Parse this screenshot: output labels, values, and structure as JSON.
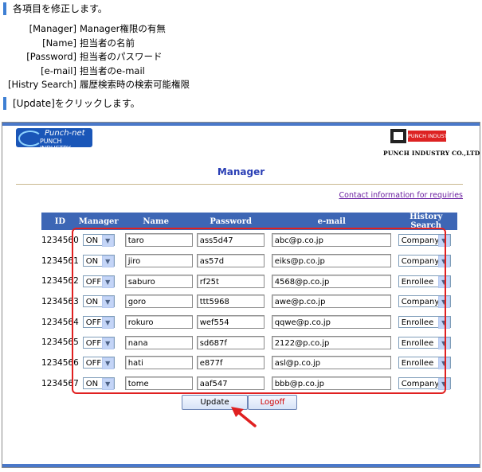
{
  "instructions": {
    "step1": "各項目を修正します。",
    "definitions": [
      {
        "key": "[Manager]",
        "desc": "Manager権限の有無"
      },
      {
        "key": "[Name]",
        "desc": "担当者の名前"
      },
      {
        "key": "[Password]",
        "desc": "担当者のパスワード"
      },
      {
        "key": "[e-mail]",
        "desc": "担当者のe-mail"
      },
      {
        "key": "[Histry Search]",
        "desc": "履歴検索時の検索可能権限"
      }
    ],
    "step2": "[Update]をクリックします。"
  },
  "header": {
    "logo_line1": "Punch-net",
    "logo_line2": "PUNCH INDUSTRY",
    "right_logo_text": "PUNCH INDUSTRY",
    "company_name": "PUNCH INDUSTRY CO.,LTD",
    "page_title": "Manager",
    "contact_link": "Contact information for requiries"
  },
  "table": {
    "columns": [
      "ID",
      "Manager",
      "Name",
      "Password",
      "e-mail",
      "History Search"
    ],
    "rows": [
      {
        "id": "1234560",
        "manager": "ON",
        "name": "taro",
        "password": "ass5d47",
        "email": "abc@p.co.jp",
        "history": "Company"
      },
      {
        "id": "1234561",
        "manager": "ON",
        "name": "jiro",
        "password": "as57d",
        "email": "eiks@p.co.jp",
        "history": "Company"
      },
      {
        "id": "1234562",
        "manager": "OFF",
        "name": "saburo",
        "password": "rf25t",
        "email": "4568@p.co.jp",
        "history": "Enrollee"
      },
      {
        "id": "1234563",
        "manager": "ON",
        "name": "goro",
        "password": "ttt5968",
        "email": "awe@p.co.jp",
        "history": "Company"
      },
      {
        "id": "1234564",
        "manager": "OFF",
        "name": "rokuro",
        "password": "wef554",
        "email": "qqwe@p.co.jp",
        "history": "Enrollee"
      },
      {
        "id": "1234565",
        "manager": "OFF",
        "name": "nana",
        "password": "sd687f",
        "email": "2122@p.co.jp",
        "history": "Enrollee"
      },
      {
        "id": "1234566",
        "manager": "OFF",
        "name": "hati",
        "password": "e877f",
        "email": "asl@p.co.jp",
        "history": "Enrollee"
      },
      {
        "id": "1234567",
        "manager": "ON",
        "name": "tome",
        "password": "aaf547",
        "email": "bbb@p.co.jp",
        "history": "Company"
      }
    ]
  },
  "buttons": {
    "update": "Update",
    "logoff": "Logoff"
  },
  "colors": {
    "accent": "#3d66b5",
    "highlight": "#e02020",
    "logoff_text": "#d00000",
    "title": "#2a3fb5"
  }
}
